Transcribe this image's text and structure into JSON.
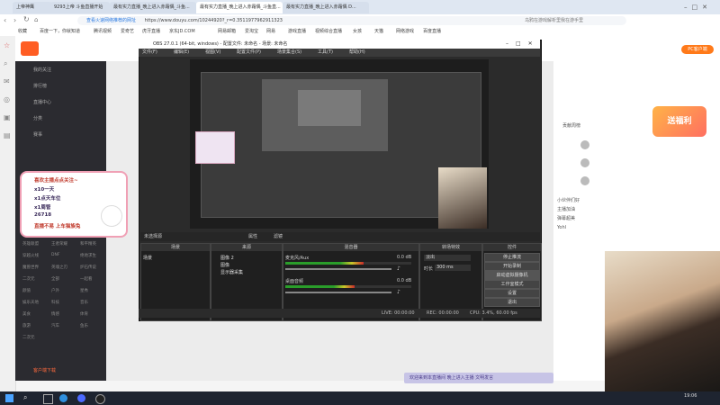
{
  "browser": {
    "tabs": [
      {
        "label": "上帝神鹰"
      },
      {
        "label": "9293上帝 斗鱼直播开始"
      },
      {
        "label": "最有实力直播_晚上进入赤霜偶_斗鱼..."
      },
      {
        "label": "最有实力直播_晚上进入赤霜偶_斗鱼直..."
      },
      {
        "label": "最有实力直播_晚上进入赤霜偶 D..."
      }
    ],
    "url": "https://www.douyu.com/10244920?_r=0.3511977962911323",
    "url_prefix": "查看火速网络推荐的网址",
    "search_hint": "乌鸦在游戏解析里我在游手里",
    "bookmarks": [
      "收藏",
      "百度一下，你就知道",
      "腾讯视频",
      "爱奇艺",
      "虎牙直播",
      "京东JD.COM",
      "网易邮箱",
      "爱淘宝",
      "网易",
      "游戏直播",
      "视频综合直播",
      "女孩",
      "天猫",
      "网络游戏",
      "百度直播"
    ]
  },
  "douyu": {
    "sidebar": {
      "items": [
        "我的关注",
        "排行榜",
        "直播中心",
        "分类",
        "赛事"
      ],
      "grid": [
        "英雄联盟",
        "王者荣耀",
        "和平精英",
        "穿越火线",
        "DNF",
        "绝地求生",
        "魔兽世界",
        "英魂之刃",
        "炉石传说",
        "二次元",
        "全部",
        "一起看",
        "颜值",
        "户外",
        "星秀",
        "娱乐天地",
        "科技",
        "音乐",
        "美食",
        "情感",
        "体育",
        "旅游",
        "汽车",
        "鱼乐",
        "二次元"
      ],
      "bottom": [
        "客户端下载"
      ]
    },
    "right": {
      "download_label": "PC客户端",
      "promo": "送福利",
      "rank_title": "贡献周榜",
      "chat_lines": [
        "小伙伴们好",
        "主播加油",
        "弹幕超美",
        "Yohl"
      ]
    },
    "chat_ticker": "欢迎来到本直播间 晚上进入主播 文明发言"
  },
  "obs": {
    "title": "OBS 27.0.1 (64-bit, windows) - 配置文件: 未命名 - 场景: 未命名",
    "menu": [
      "文件(F)",
      "编辑(E)",
      "视图(V)",
      "配置文件(P)",
      "场景集合(S)",
      "工具(T)",
      "帮助(H)"
    ],
    "preview_label": "未选择源",
    "props_label": "属性",
    "filters_label": "滤镜",
    "docks": {
      "scenes": {
        "title": "场景",
        "items": [
          "场景"
        ]
      },
      "sources": {
        "title": "来源",
        "items": [
          "图像 2",
          "图像",
          "显示器采集"
        ]
      },
      "mixer": {
        "title": "混音器",
        "channels": [
          {
            "name": "麦克风/Aux",
            "level": "0.0 dB",
            "fill": 0.62
          },
          {
            "name": "桌面音频",
            "level": "0.0 dB",
            "fill": 0.55
          }
        ]
      },
      "transitions": {
        "title": "转场特效",
        "type": "淡出",
        "duration_label": "时长",
        "duration": "300 ms"
      },
      "controls": {
        "title": "控件",
        "buttons": [
          "停止推流",
          "开始录制",
          "启动虚拟摄像机",
          "工作室模式",
          "设置",
          "退出"
        ]
      }
    },
    "status": {
      "live": "LIVE: 00:00:00",
      "rec": "REC: 00:00:00",
      "cpu": "CPU: 3.4%, 60.00 fps"
    }
  },
  "overlay": {
    "header": "喜欢主播点点关注~",
    "lines": [
      "x10一天",
      "x1点天车位",
      "x1周管",
      "26718",
      "直播不易 上车猫族兔"
    ]
  },
  "clock": {
    "time": "19:06"
  }
}
